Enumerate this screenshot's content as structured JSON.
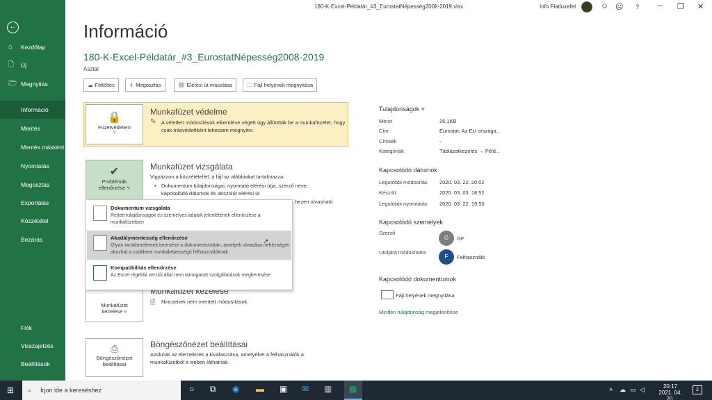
{
  "window": {
    "title": "180-K-Excel-Példatár_#3_EurostatNépesség2008-2019.xlsx",
    "user": "Info Fiatluxefel",
    "buttons": [
      "☺",
      "☹",
      "?",
      "─",
      "❐",
      "✕"
    ]
  },
  "sidebar": {
    "back": "←",
    "top_items": [
      {
        "icon": "⌂",
        "label": "Kezdőlap"
      },
      {
        "icon": "🗋",
        "label": "Új"
      },
      {
        "icon": "🗁",
        "label": "Megnyitás"
      }
    ],
    "items": [
      "Információ",
      "Mentés",
      "Mentés másként",
      "Nyomtatás",
      "Megosztás",
      "Exportálás",
      "Közzététel",
      "Bezárás"
    ],
    "bottom_items": [
      "Fiók",
      "Visszajelzés",
      "Beállítások"
    ]
  },
  "main": {
    "heading": "Információ",
    "filename": "180-K-Excel-Példatár_#3_EurostatNépesség2008-2019",
    "location": "Asztal",
    "actions": [
      "Feltöltés",
      "Megosztás",
      "Elérési út másolása",
      "Fájl helyének megnyitása"
    ],
    "protect": {
      "button": "Füzetvédelem",
      "title": "Munkafüzet védelme",
      "text": "A véletlen módosítások elkerülése végett úgy állították be a munkafüzetet, hogy csak írásvédettként lehessen megnyitni."
    },
    "inspect": {
      "button1": "Problémák",
      "button2": "ellenőrzése",
      "title": "Munkafüzet vizsgálata",
      "text": "Vigyázzon a közzététellel, a fájl az alábbiakat tartalmazza:",
      "bullet": "Dokumentum tulajdonságai, nyomtató elérési útja, szerző neve, kapcsolódó dátumok és abszolút elérési út",
      "hidden": "hezen olvasható"
    },
    "manage": {
      "button1": "Munkafüzet",
      "button2": "kezelése",
      "title": "Munkafüzet kezelése",
      "text": "Nincsenek nem mentett módosítások."
    },
    "browser": {
      "button1": "Böngészőnézet",
      "button2": "beállításai",
      "title": "Böngészőnézet beállításai",
      "text": "Azoknak az elemeknek a kiválasztása, amelyeket a felhasználók a munkafüzetből a weben láthatnak."
    }
  },
  "dropdown": [
    {
      "title": "Dokumentum vizsgálata",
      "desc": "Rejtett tulajdonságok és személyes adatok jelenlétének ellenőrzése a munkafüzetben"
    },
    {
      "title": "Akadálymentesség ellenőrzése",
      "desc": "Olyan tartalomelemek keresése a dokumentumban, amelyek olvasása nehézséget okozhat a csökkent munkaképességű felhasználóknak"
    },
    {
      "title": "Kompatibilitás ellenőrzése",
      "desc": "Az Excel régebbi verziói által nem támogatott szolgáltatások megkeresése"
    }
  ],
  "properties": {
    "heading": "Tulajdonságok ˅",
    "rows": [
      {
        "label": "Méret",
        "value": "26,1KB"
      },
      {
        "label": "Cím",
        "value": "Eurostat: Az EU országa..."
      },
      {
        "label": "Címkék",
        "value": "-"
      },
      {
        "label": "Kategóriák",
        "value": "Táblázatkezelés → Péld..."
      }
    ],
    "dates_heading": "Kapcsolódó dátumok",
    "dates": [
      {
        "label": "Legutóbbi módosítás",
        "value": "2020. 03. 22. 20:02"
      },
      {
        "label": "Készült",
        "value": "2020. 03. 03. 18:52"
      },
      {
        "label": "Legutóbbi nyomtatás",
        "value": "2020. 03. 22. 19:50"
      }
    ],
    "people_heading": "Kapcsolódó személyek",
    "author_label": "Szerző",
    "author_initial": "G",
    "author_name": "GF",
    "modifier_label": "Utoljára módosította",
    "modifier_initial": "F",
    "modifier_name": "Felhasználó",
    "docs_heading": "Kapcsolódó dokumentumok",
    "open_location": "Fájl helyének megnyitása",
    "show_all": "Minden tulajdonság megjelenítése"
  },
  "taskbar": {
    "search_placeholder": "Írjon ide a kereséshez",
    "time": "20:17",
    "date": "2021. 04. 20.",
    "notif": "2"
  }
}
